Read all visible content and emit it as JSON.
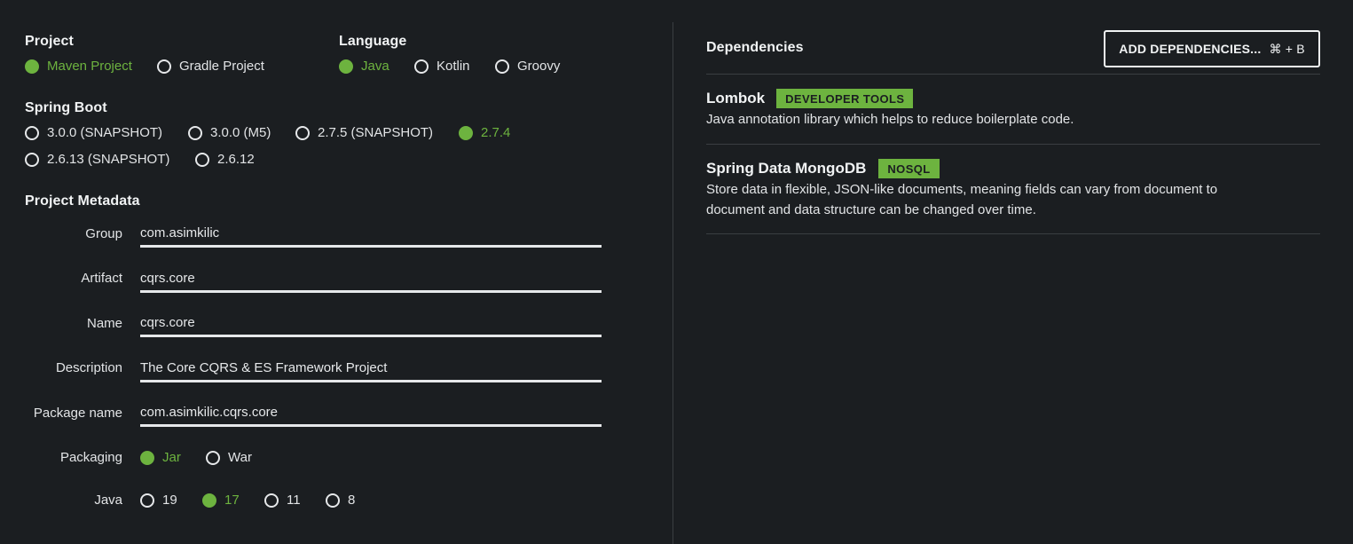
{
  "project": {
    "title": "Project",
    "options": [
      {
        "label": "Maven Project",
        "selected": true
      },
      {
        "label": "Gradle Project",
        "selected": false
      }
    ]
  },
  "language": {
    "title": "Language",
    "options": [
      {
        "label": "Java",
        "selected": true
      },
      {
        "label": "Kotlin",
        "selected": false
      },
      {
        "label": "Groovy",
        "selected": false
      }
    ]
  },
  "spring_boot": {
    "title": "Spring Boot",
    "options": [
      {
        "label": "3.0.0 (SNAPSHOT)",
        "selected": false
      },
      {
        "label": "3.0.0 (M5)",
        "selected": false
      },
      {
        "label": "2.7.5 (SNAPSHOT)",
        "selected": false
      },
      {
        "label": "2.7.4",
        "selected": true
      },
      {
        "label": "2.6.13 (SNAPSHOT)",
        "selected": false
      },
      {
        "label": "2.6.12",
        "selected": false
      }
    ]
  },
  "metadata": {
    "title": "Project Metadata",
    "group": {
      "label": "Group",
      "value": "com.asimkilic"
    },
    "artifact": {
      "label": "Artifact",
      "value": "cqrs.core"
    },
    "name": {
      "label": "Name",
      "value": "cqrs.core"
    },
    "description": {
      "label": "Description",
      "value": "The Core CQRS & ES Framework Project"
    },
    "package_name": {
      "label": "Package name",
      "value": "com.asimkilic.cqrs.core"
    },
    "packaging": {
      "label": "Packaging",
      "options": [
        {
          "label": "Jar",
          "selected": true
        },
        {
          "label": "War",
          "selected": false
        }
      ]
    },
    "java": {
      "label": "Java",
      "options": [
        {
          "label": "19",
          "selected": false
        },
        {
          "label": "17",
          "selected": true
        },
        {
          "label": "11",
          "selected": false
        },
        {
          "label": "8",
          "selected": false
        }
      ]
    }
  },
  "dependencies": {
    "title": "Dependencies",
    "add_button": {
      "label": "ADD DEPENDENCIES...",
      "shortcut": "⌘ + B"
    },
    "items": [
      {
        "name": "Lombok",
        "badge": "DEVELOPER TOOLS",
        "description": "Java annotation library which helps to reduce boilerplate code."
      },
      {
        "name": "Spring Data MongoDB",
        "badge": "NOSQL",
        "description": "Store data in flexible, JSON-like documents, meaning fields can vary from document to document and data structure can be changed over time."
      }
    ]
  },
  "colors": {
    "accent": "#6db33f",
    "background": "#1b1e21",
    "text": "#e6e8ea"
  }
}
